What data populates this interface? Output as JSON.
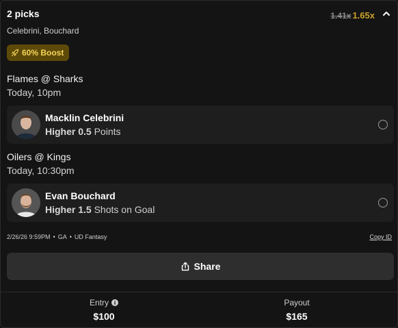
{
  "header": {
    "title": "2 picks",
    "subtitle": "Celebrini, Bouchard",
    "old_multiplier": "1.41x",
    "new_multiplier": "1.65x"
  },
  "boost": {
    "label": "60% Boost"
  },
  "games": [
    {
      "teams": "Flames @ Sharks",
      "time": "Today, 10pm",
      "pick": {
        "player": "Macklin Celebrini",
        "direction": "Higher",
        "line": "0.5",
        "stat": "Points"
      }
    },
    {
      "teams": "Oilers @ Kings",
      "time": "Today, 10:30pm",
      "pick": {
        "player": "Evan Bouchard",
        "direction": "Higher",
        "line": "1.5",
        "stat": "Shots on Goal"
      }
    }
  ],
  "meta": {
    "timestamp": "2/26/26 9:59PM",
    "state": "GA",
    "platform": "UD Fantasy",
    "copy_id": "Copy ID"
  },
  "share_label": "Share",
  "footer": {
    "entry_label": "Entry",
    "entry_value": "$100",
    "payout_label": "Payout",
    "payout_value": "$165"
  },
  "colors": {
    "accent_gold": "#c9a227",
    "boost_bg": "#5e4a08",
    "boost_text": "#f6d458"
  }
}
